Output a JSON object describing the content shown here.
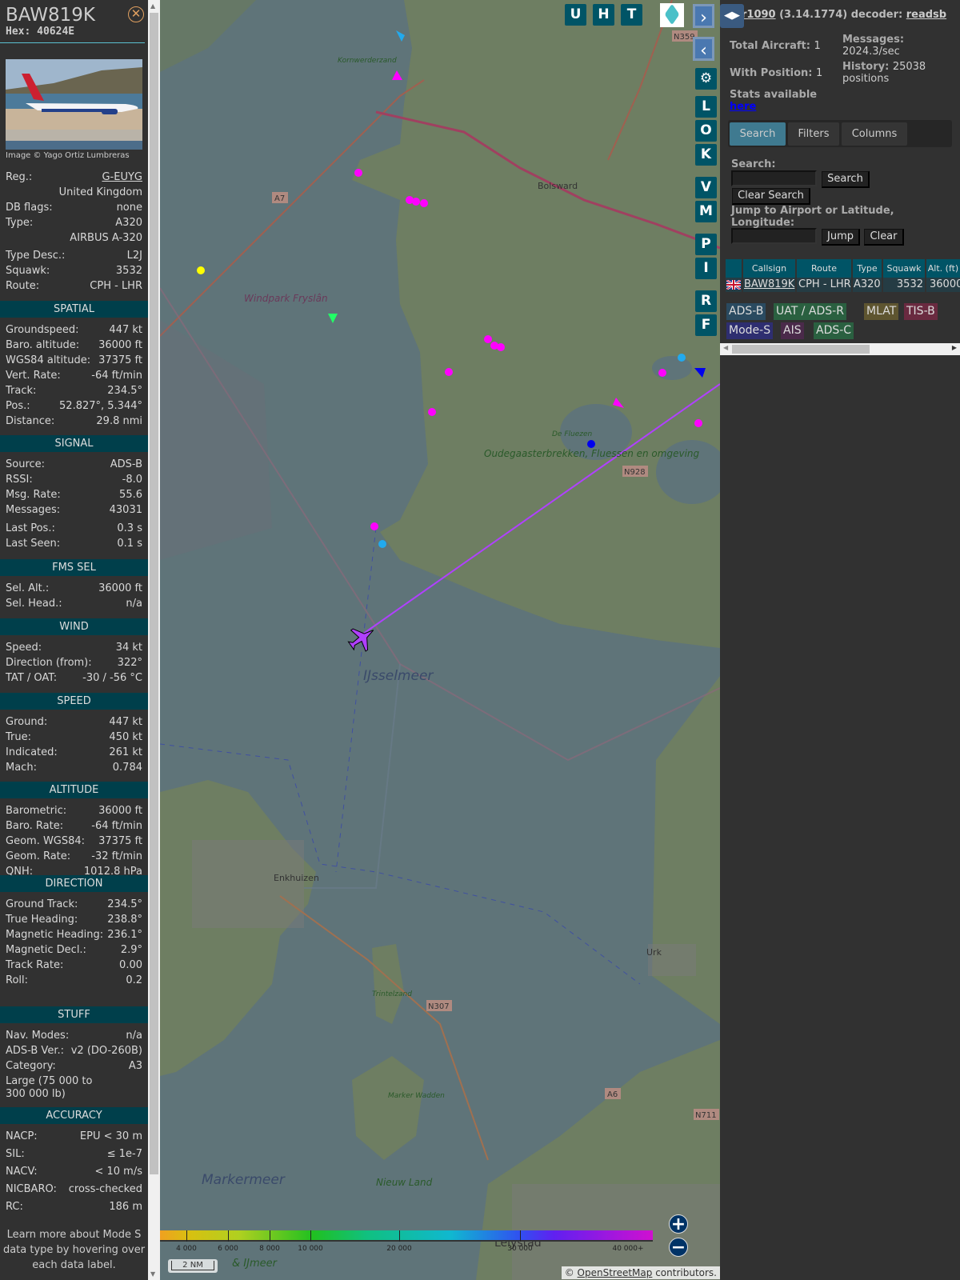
{
  "aircraft": {
    "callsign": "BAW819K",
    "hex_label": "Hex: 40624E",
    "photo_credit": "Image © Yago Ortiz Lumbreras"
  },
  "info": [
    {
      "label": "Reg.:",
      "value": "G-EUYG"
    },
    {
      "label": "",
      "value": "United Kingdom"
    },
    {
      "label": "DB flags:",
      "value": "none"
    },
    {
      "label": "Type:",
      "value": "A320"
    },
    {
      "label": "",
      "value": "AIRBUS A-320"
    },
    {
      "label": "Type Desc.:",
      "value": "L2J"
    },
    {
      "label": "Squawk:",
      "value": "3532"
    },
    {
      "label": "Route:",
      "value": "CPH - LHR"
    }
  ],
  "sections": [
    {
      "title": "SPATIAL",
      "rows": [
        [
          "Groundspeed:",
          "447 kt"
        ],
        [
          "Baro. altitude:",
          "36000 ft"
        ],
        [
          "WGS84 altitude:",
          "37375 ft"
        ],
        [
          "Vert. Rate:",
          "-64 ft/min"
        ],
        [
          "Track:",
          "234.5°"
        ],
        [
          "Pos.:",
          "52.827°, 5.344°"
        ],
        [
          "Distance:",
          "29.8 nmi"
        ]
      ]
    },
    {
      "title": "SIGNAL",
      "rows": [
        [
          "Source:",
          "ADS-B"
        ],
        [
          "RSSI:",
          "-8.0"
        ],
        [
          "Msg. Rate:",
          "55.6"
        ],
        [
          "Messages:",
          "43031"
        ],
        [
          "Last Pos.:",
          "0.3 s"
        ],
        [
          "Last Seen:",
          "0.1 s"
        ]
      ]
    },
    {
      "title": "FMS SEL",
      "rows": [
        [
          "Sel. Alt.:",
          "36000 ft"
        ],
        [
          "Sel. Head.:",
          "n/a"
        ]
      ]
    },
    {
      "title": "WIND",
      "rows": [
        [
          "Speed:",
          "34 kt"
        ],
        [
          "Direction (from):",
          "322°"
        ],
        [
          "TAT / OAT:",
          "-30 / -56 °C"
        ]
      ]
    },
    {
      "title": "SPEED",
      "rows": [
        [
          "Ground:",
          "447 kt"
        ],
        [
          "True:",
          "450 kt"
        ],
        [
          "Indicated:",
          "261 kt"
        ],
        [
          "Mach:",
          "0.784"
        ]
      ]
    },
    {
      "title": "ALTITUDE",
      "rows": [
        [
          "Barometric:",
          "36000 ft"
        ],
        [
          "Baro. Rate:",
          "-64 ft/min"
        ],
        [
          "Geom. WGS84:",
          "37375 ft"
        ],
        [
          "Geom. Rate:",
          "-32 ft/min"
        ],
        [
          "QNH:",
          "1012.8 hPa"
        ]
      ]
    },
    {
      "title": "DIRECTION",
      "rows": [
        [
          "Ground Track:",
          "234.5°"
        ],
        [
          "True Heading:",
          "238.8°"
        ],
        [
          "Magnetic Heading:",
          "236.1°"
        ],
        [
          "Magnetic Decl.:",
          "2.9°"
        ],
        [
          "Track Rate:",
          "0.00"
        ],
        [
          "Roll:",
          "0.2"
        ]
      ]
    },
    {
      "title": "STUFF",
      "rows": [
        [
          "Nav. Modes:",
          "n/a"
        ],
        [
          "ADS-B Ver.:",
          "v2 (DO-260B)"
        ],
        [
          "Category:",
          "A3"
        ],
        [
          "Large (75 000 to 300 000 lb)",
          ""
        ]
      ]
    },
    {
      "title": "ACCURACY",
      "rows": [
        [
          "NACP:",
          "EPU < 30 m"
        ],
        [
          "SIL:",
          "≤ 1e-7"
        ],
        [
          "NACV:",
          "< 10 m/s"
        ],
        [
          "NICBARO:",
          "cross-checked"
        ],
        [
          "RC:",
          "186 m"
        ]
      ]
    }
  ],
  "learn_more": "Learn more about Mode S data type by hovering over each data label.",
  "map": {
    "top_buttons": [
      "U",
      "H",
      "T"
    ],
    "side_buttons": [
      "L",
      "O",
      "K",
      "V",
      "M",
      "P",
      "I",
      "R",
      "F"
    ],
    "labels": {
      "ijsselmeer": "IJsselmeer",
      "markermeer": "Markermeer",
      "markermeer2": "& IJmeer",
      "enkhuizen": "Enkhuizen",
      "bolsward": "Bolsward",
      "urk": "Urk",
      "lelystad": "Lelystad",
      "nieuwland": "Nieuw Land",
      "windpark": "Windpark Fryslân",
      "oudega": "Oudegaasterbrekken, Fluessen en omgeving",
      "fluezen": "De Fluezen",
      "trintelzand": "Trintelzand",
      "markerwadden": "Marker Wadden",
      "kornwerd": "Kornwerderzand",
      "a7": "A7",
      "a6": "A6",
      "n359": "N359",
      "n928": "N928",
      "n307": "N307",
      "n711": "N711"
    },
    "altitude_scale": [
      "4 000",
      "6 000",
      "8 000",
      "10 000",
      "20 000",
      "30 000",
      "40 000+"
    ],
    "scale_bar": "2 NM",
    "attribution_prefix": "© ",
    "attribution_link": "OpenStreetMap",
    "attribution_suffix": " contributors.",
    "track_color": "#b040ff"
  },
  "panel": {
    "title_link": "tar1090",
    "version": " (3.14.1774) decoder: ",
    "decoder": "readsb",
    "total_label": "Total Aircraft:",
    "total": "1",
    "withpos_label": "With Position:",
    "withpos": "1",
    "messages_label": "Messages:",
    "messages": "2024.3/sec",
    "history_label": "History:",
    "history": "25038 positions",
    "stats_label": "Stats available",
    "stats_link": "here",
    "tabs": [
      "Search",
      "Filters",
      "Columns"
    ],
    "search_label": "Search:",
    "search_btn": "Search",
    "clear_search_btn": "Clear Search",
    "jump_label": "Jump to Airport or Latitude, Longitude:",
    "jump_btn": "Jump",
    "clear_btn": "Clear",
    "table_headers": [
      "",
      "Callsign",
      "Route",
      "Type",
      "Squawk",
      "Alt. (ft)"
    ],
    "table_row": {
      "callsign": "BAW819K",
      "route": "CPH - LHR",
      "type": "A320",
      "squawk": "3532",
      "alt": "36000"
    },
    "legend": [
      {
        "label": "ADS-B",
        "color": "#2a4a60"
      },
      {
        "label": "UAT / ADS-R",
        "color": "#2a6040"
      },
      {
        "label": "MLAT",
        "color": "#5e5530"
      },
      {
        "label": "TIS-B",
        "color": "#6a2a40"
      },
      {
        "label": "Mode-S",
        "color": "#2e2e70"
      },
      {
        "label": "AIS",
        "color": "#4a2a4a"
      },
      {
        "label": "ADS-C",
        "color": "#2a6040"
      }
    ]
  }
}
